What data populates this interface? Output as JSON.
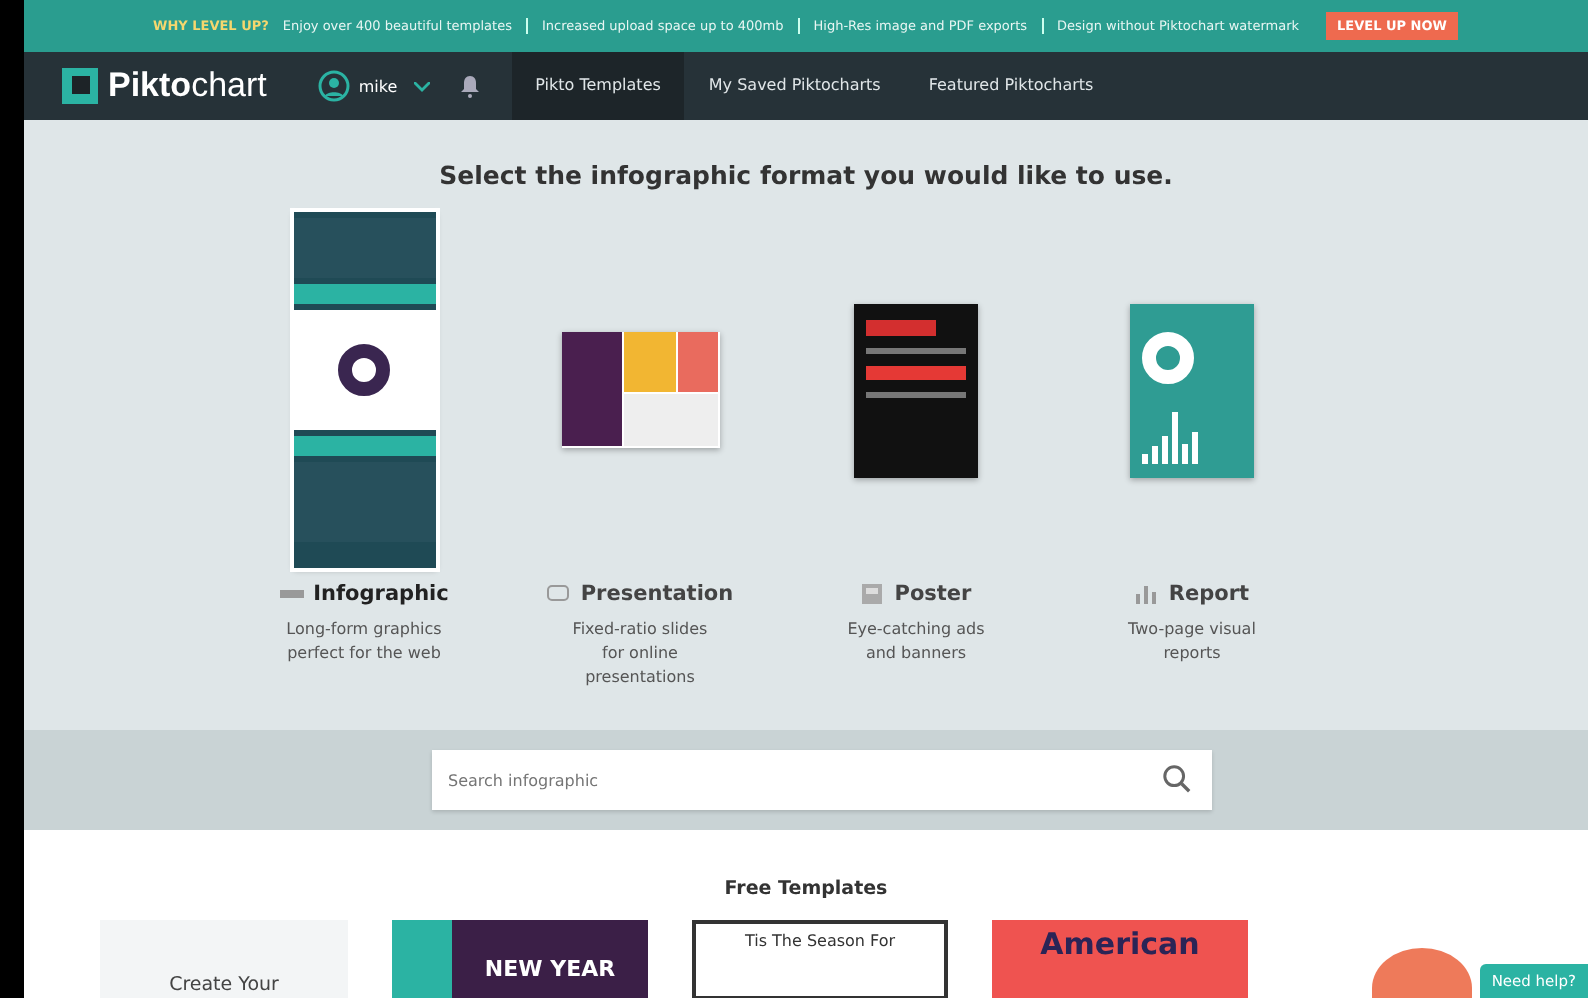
{
  "promo_bar": {
    "lead": "WHY LEVEL UP?",
    "perks": [
      "Enjoy over 400 beautiful templates",
      "Increased upload space up to 400mb",
      "High-Res image and PDF exports",
      "Design without Piktochart watermark"
    ],
    "button": "LEVEL UP NOW"
  },
  "nav": {
    "logo_bold": "Pikto",
    "logo_light": "chart",
    "user": "mike",
    "links": [
      {
        "label": "Pikto Templates",
        "selected": true
      },
      {
        "label": "My Saved Piktocharts",
        "selected": false
      },
      {
        "label": "Featured Piktocharts",
        "selected": false
      }
    ]
  },
  "heading": "Select the infographic format you would like to use.",
  "formats": [
    {
      "kind": "infographic",
      "label": "Infographic",
      "description": "Long-form graphics perfect for the web",
      "selected": true
    },
    {
      "kind": "presentation",
      "label": "Presentation",
      "description": "Fixed-ratio slides for online presentations",
      "selected": false
    },
    {
      "kind": "poster",
      "label": "Poster",
      "description": "Eye-catching ads and banners",
      "selected": false
    },
    {
      "kind": "report",
      "label": "Report",
      "description": "Two-page visual reports",
      "selected": false
    }
  ],
  "search": {
    "placeholder": "Search infographic"
  },
  "free_templates": {
    "title": "Free Templates",
    "create_card": "Create Your",
    "cards": [
      {
        "kind": "newyear",
        "text": "NEW YEAR"
      },
      {
        "kind": "season",
        "text": "Tis The Season For"
      },
      {
        "kind": "literature",
        "text": "American"
      }
    ]
  },
  "help_button": "Need help?"
}
